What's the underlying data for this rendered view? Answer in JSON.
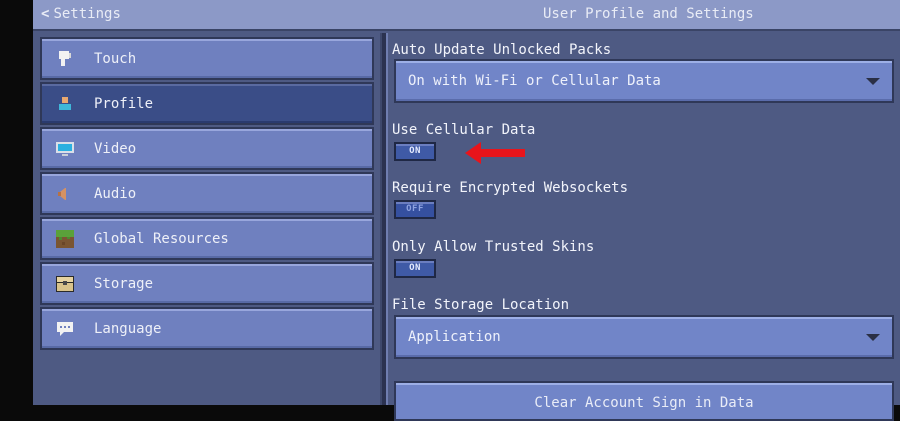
{
  "header": {
    "back_label": "Settings",
    "title": "User Profile and Settings"
  },
  "sidebar": {
    "items": [
      {
        "label": "Touch",
        "icon": "hand-pointer-icon",
        "selected": false
      },
      {
        "label": "Profile",
        "icon": "person-icon",
        "selected": true
      },
      {
        "label": "Video",
        "icon": "monitor-icon",
        "selected": false
      },
      {
        "label": "Audio",
        "icon": "speaker-icon",
        "selected": false
      },
      {
        "label": "Global Resources",
        "icon": "grass-block-icon",
        "selected": false
      },
      {
        "label": "Storage",
        "icon": "chest-icon",
        "selected": false
      },
      {
        "label": "Language",
        "icon": "speech-bubble-icon",
        "selected": false
      }
    ]
  },
  "settings": {
    "auto_update": {
      "label": "Auto Update Unlocked Packs",
      "value": "On with Wi-Fi or Cellular Data"
    },
    "cellular": {
      "label": "Use Cellular Data",
      "state": "ON"
    },
    "encrypted": {
      "label": "Require Encrypted Websockets",
      "state": "OFF"
    },
    "trusted_skins": {
      "label": "Only Allow Trusted Skins",
      "state": "ON"
    },
    "file_storage": {
      "label": "File Storage Location",
      "value": "Application"
    },
    "clear_button": {
      "label": "Clear Account Sign in Data"
    }
  },
  "annotation": {
    "arrow_color": "#e8141b"
  }
}
